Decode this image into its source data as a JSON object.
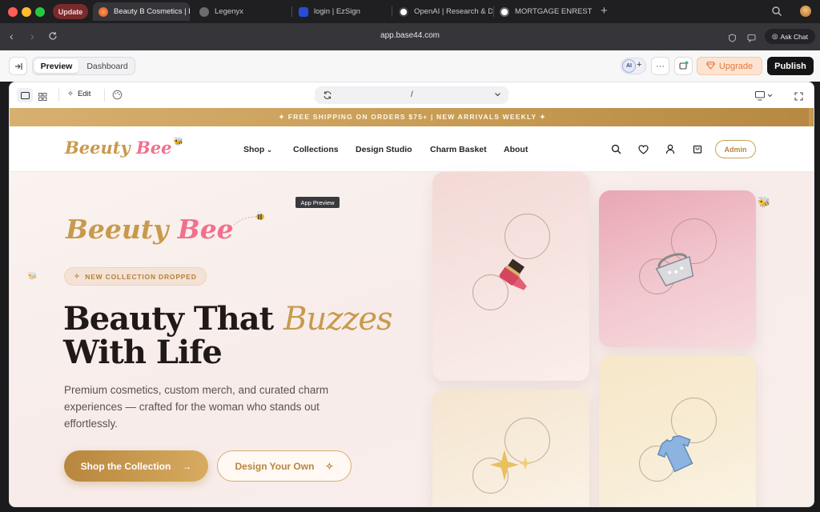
{
  "browser": {
    "update_label": "Update",
    "tabs": [
      {
        "title": "Beauty B Cosmetics | E",
        "active": true
      },
      {
        "title": "Legenyx",
        "active": false
      },
      {
        "title": "login | EzSign",
        "active": false
      },
      {
        "title": "OpenAI | Research & D",
        "active": false
      },
      {
        "title": "MORTGAGE ENREST -",
        "active": false
      }
    ],
    "new_tab": "+",
    "url": "app.base44.com",
    "ask_chat": "Ask Chat"
  },
  "app_toolbar": {
    "preview_label": "Preview",
    "dashboard_label": "Dashboard",
    "avatar": "AI",
    "plus": "+",
    "more": "···",
    "upgrade_label": "Upgrade",
    "publish_label": "Publish"
  },
  "preview_toolbar": {
    "edit_label": "Edit",
    "route": "/"
  },
  "site": {
    "promo_banner": "✦ FREE SHIPPING ON ORDERS $75+  |  NEW ARRIVALS WEEKLY ✦",
    "logo_text": "Beeuty Bee",
    "nav": {
      "shop": "Shop",
      "collections": "Collections",
      "design_studio": "Design Studio",
      "charm_basket": "Charm Basket",
      "about": "About"
    },
    "admin_label": "Admin",
    "hero": {
      "logo_text": "Beeuty Bee",
      "badge": "NEW COLLECTION DROPPED",
      "title_line1": "Beauty That ",
      "title_accent": "Buzzes",
      "title_line2": "With Life",
      "subtitle": "Premium cosmetics, custom merch, and curated charm experiences — crafted for the woman who stands out effortlessly.",
      "cta_primary": "Shop the Collection",
      "cta_secondary": "Design Your Own"
    },
    "tooltip": "App Preview"
  },
  "colors": {
    "gold": "#c89a4d",
    "pink_logo": "#f0718d",
    "publish_bg": "#141416",
    "upgrade_text": "#e27a3e"
  }
}
